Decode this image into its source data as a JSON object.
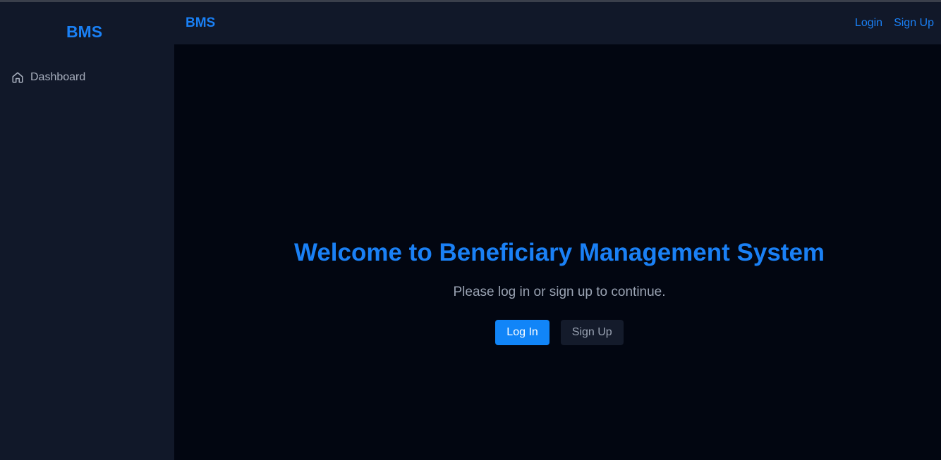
{
  "sidebar": {
    "brand": "BMS",
    "items": [
      {
        "icon": "home-icon",
        "label": "Dashboard"
      }
    ]
  },
  "header": {
    "brand": "BMS",
    "nav": {
      "login_label": "Login",
      "signup_label": "Sign Up"
    }
  },
  "main": {
    "title": "Welcome to Beneficiary Management System",
    "subtitle": "Please log in or sign up to continue.",
    "login_button": "Log In",
    "signup_button": "Sign Up"
  },
  "colors": {
    "accent": "#1a80f5",
    "primary_button": "#1185f8",
    "sidebar_bg": "#111829",
    "main_bg": "#020611"
  }
}
